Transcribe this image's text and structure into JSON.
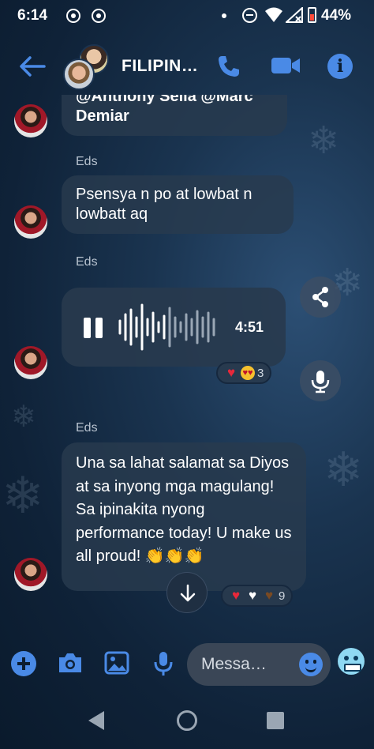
{
  "status_bar": {
    "time": "6:14",
    "battery": "44%"
  },
  "header": {
    "title": "FILIPIN…"
  },
  "messages": {
    "top_cut_line": "@Anthony Sella @Marc",
    "top_cut_bottom": "Demiar",
    "m1": {
      "sender": "Eds",
      "text": "Psensya n po at lowbat n lowbatt aq"
    },
    "m2": {
      "sender": "Eds",
      "duration": "4:51",
      "reaction_count": "3"
    },
    "m3": {
      "sender": "Eds",
      "text": "Una sa lahat salamat sa Diyos at sa inyong mga magulang! Sa ipinakita nyong performance today! U make us all proud! 👏👏👏",
      "reaction_count": "9"
    }
  },
  "composer": {
    "placeholder": "Messa…"
  },
  "icons": {
    "back": "arrow-left-icon",
    "call": "phone-icon",
    "video": "video-camera-icon",
    "info": "info-icon",
    "share": "share-icon",
    "mic": "microphone-icon",
    "plus": "plus-icon",
    "camera": "camera-icon",
    "gallery": "image-icon",
    "emoji": "emoji-icon",
    "scroll": "arrow-down-icon"
  },
  "colors": {
    "accent": "#4a8ae6",
    "bubble": "#283a4e"
  }
}
